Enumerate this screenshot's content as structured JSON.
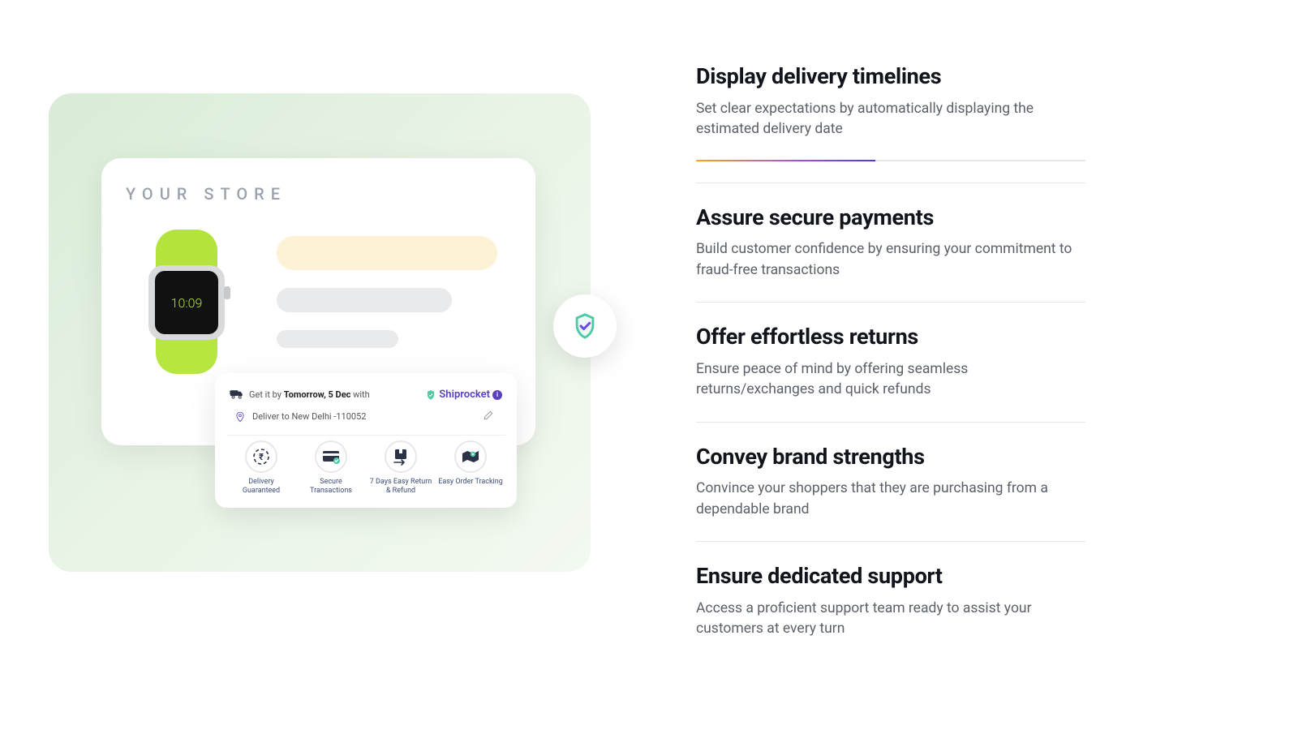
{
  "store": {
    "title": "YOUR STORE",
    "watch_time": "10:09"
  },
  "delivery_widget": {
    "getit_prefix": "Get it by ",
    "getit_date": "Tomorrow, 5 Dec",
    "getit_suffix": " with",
    "brand": "Shiprocket",
    "deliver_to": "Deliver to New Delhi -110052",
    "badges": [
      {
        "label": "Delivery Guaranteed",
        "icon": "rupee-refresh"
      },
      {
        "label": "Secure Transactions",
        "icon": "card-check"
      },
      {
        "label": "7 Days Easy Return & Refund",
        "icon": "box-return"
      },
      {
        "label": "Easy Order Tracking",
        "icon": "map-pin"
      }
    ]
  },
  "features": [
    {
      "title": "Display delivery timelines",
      "desc": "Set clear expectations by automatically displaying the estimated delivery date",
      "active": true
    },
    {
      "title": "Assure secure payments",
      "desc": "Build customer confidence by ensuring your commitment to fraud-free transactions"
    },
    {
      "title": "Offer effortless returns",
      "desc": "Ensure peace of mind by offering seamless returns/exchanges and quick refunds"
    },
    {
      "title": "Convey brand strengths",
      "desc": "Convince your shoppers that they are purchasing from a dependable brand"
    },
    {
      "title": "Ensure dedicated support",
      "desc": "Access a proficient support team ready to assist your customers at every turn"
    }
  ]
}
